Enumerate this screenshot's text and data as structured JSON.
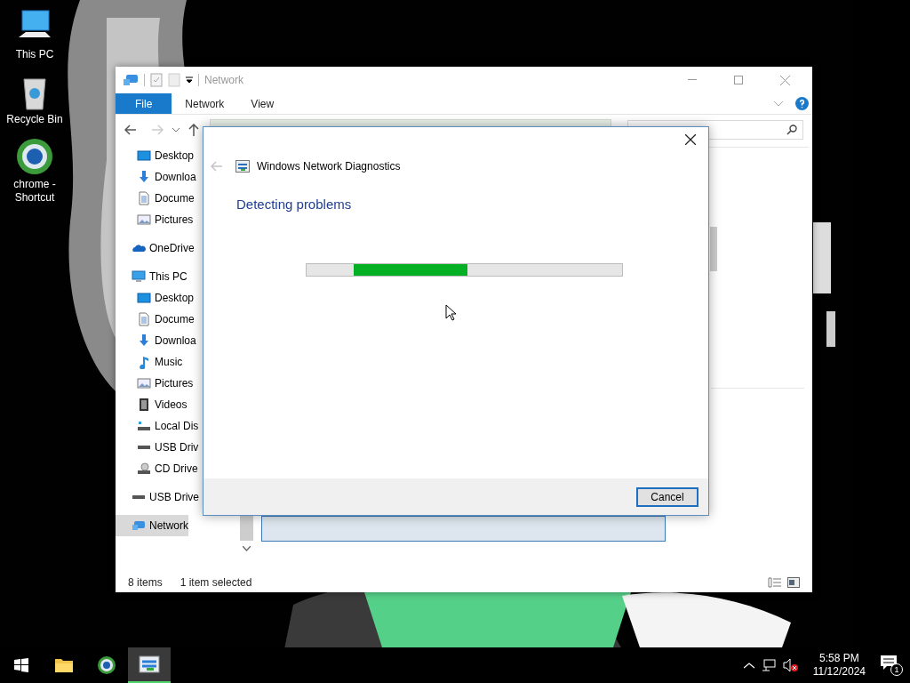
{
  "desktop_icons": [
    {
      "label": "This PC",
      "kind": "pc"
    },
    {
      "label": "Recycle Bin",
      "kind": "bin"
    },
    {
      "label": "chrome -\nShortcut",
      "kind": "globe"
    }
  ],
  "explorer": {
    "title": "Network",
    "ribbon_tabs": [
      {
        "label": "File",
        "selected": true
      },
      {
        "label": "Network",
        "selected": false
      },
      {
        "label": "View",
        "selected": false
      }
    ],
    "sidebar": {
      "pinned": [
        {
          "label": "Desktop",
          "kind": "desktop",
          "selected": false
        },
        {
          "label": "Downloa",
          "kind": "download",
          "selected": false
        },
        {
          "label": "Docume",
          "kind": "document",
          "selected": false
        },
        {
          "label": "Pictures",
          "kind": "pictures",
          "selected": false
        }
      ],
      "items": [
        {
          "label": "OneDrive",
          "kind": "cloud",
          "selected": false
        },
        {
          "label": "This PC",
          "kind": "pc",
          "selected": false,
          "children": [
            {
              "label": "Desktop",
              "kind": "desktop",
              "selected": false
            },
            {
              "label": "Docume",
              "kind": "document",
              "selected": false
            },
            {
              "label": "Downloa",
              "kind": "download",
              "selected": false
            },
            {
              "label": "Music",
              "kind": "music",
              "selected": false
            },
            {
              "label": "Pictures",
              "kind": "pictures",
              "selected": false
            },
            {
              "label": "Videos",
              "kind": "video",
              "selected": false
            },
            {
              "label": "Local Dis",
              "kind": "disk",
              "selected": false
            },
            {
              "label": "USB Driv",
              "kind": "usb",
              "selected": false
            },
            {
              "label": "CD Drive",
              "kind": "cd",
              "selected": false
            }
          ]
        },
        {
          "label": "USB Drive",
          "kind": "usb",
          "selected": false
        },
        {
          "label": "Network",
          "kind": "network",
          "selected": true
        }
      ]
    },
    "status_bar": {
      "item_count": "8 items",
      "selection": "1 item selected"
    }
  },
  "dialog": {
    "title": "Windows Network Diagnostics",
    "heading": "Detecting problems",
    "progress": {
      "level": 0.36
    },
    "buttons": [
      "Cancel"
    ]
  },
  "taskbar": {
    "apps": [
      {
        "kind": "folder",
        "active": false
      },
      {
        "kind": "globe",
        "active": false
      },
      {
        "kind": "diagnostics",
        "active": true
      }
    ],
    "time": "5:58 PM",
    "date": "11/12/2024",
    "notifications": "1"
  }
}
